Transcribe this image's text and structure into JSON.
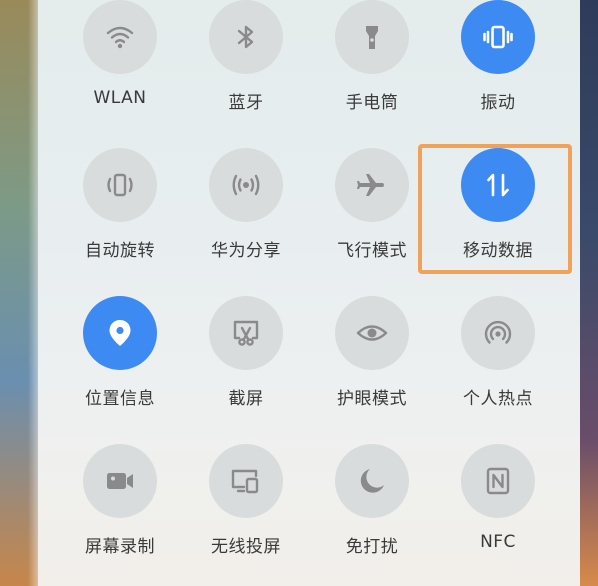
{
  "colors": {
    "active": "#3d8bf2",
    "inactive": "#d9dcdc",
    "highlight_border": "#f0a15a"
  },
  "tiles": [
    {
      "label": "WLAN",
      "icon": "wifi-icon",
      "active": false
    },
    {
      "label": "蓝牙",
      "icon": "bluetooth-icon",
      "active": false
    },
    {
      "label": "手电筒",
      "icon": "flashlight-icon",
      "active": false
    },
    {
      "label": "振动",
      "icon": "vibrate-icon",
      "active": true
    },
    {
      "label": "自动旋转",
      "icon": "auto-rotate-icon",
      "active": false
    },
    {
      "label": "华为分享",
      "icon": "huawei-share-icon",
      "active": false
    },
    {
      "label": "飞行模式",
      "icon": "airplane-icon",
      "active": false
    },
    {
      "label": "移动数据",
      "icon": "mobile-data-icon",
      "active": true
    },
    {
      "label": "位置信息",
      "icon": "location-icon",
      "active": true
    },
    {
      "label": "截屏",
      "icon": "screenshot-icon",
      "active": false
    },
    {
      "label": "护眼模式",
      "icon": "eye-icon",
      "active": false
    },
    {
      "label": "个人热点",
      "icon": "hotspot-icon",
      "active": false
    },
    {
      "label": "屏幕录制",
      "icon": "screen-record-icon",
      "active": false
    },
    {
      "label": "无线投屏",
      "icon": "wireless-projection-icon",
      "active": false
    },
    {
      "label": "免打扰",
      "icon": "moon-icon",
      "active": false
    },
    {
      "label": "NFC",
      "icon": "nfc-icon",
      "active": false
    }
  ]
}
